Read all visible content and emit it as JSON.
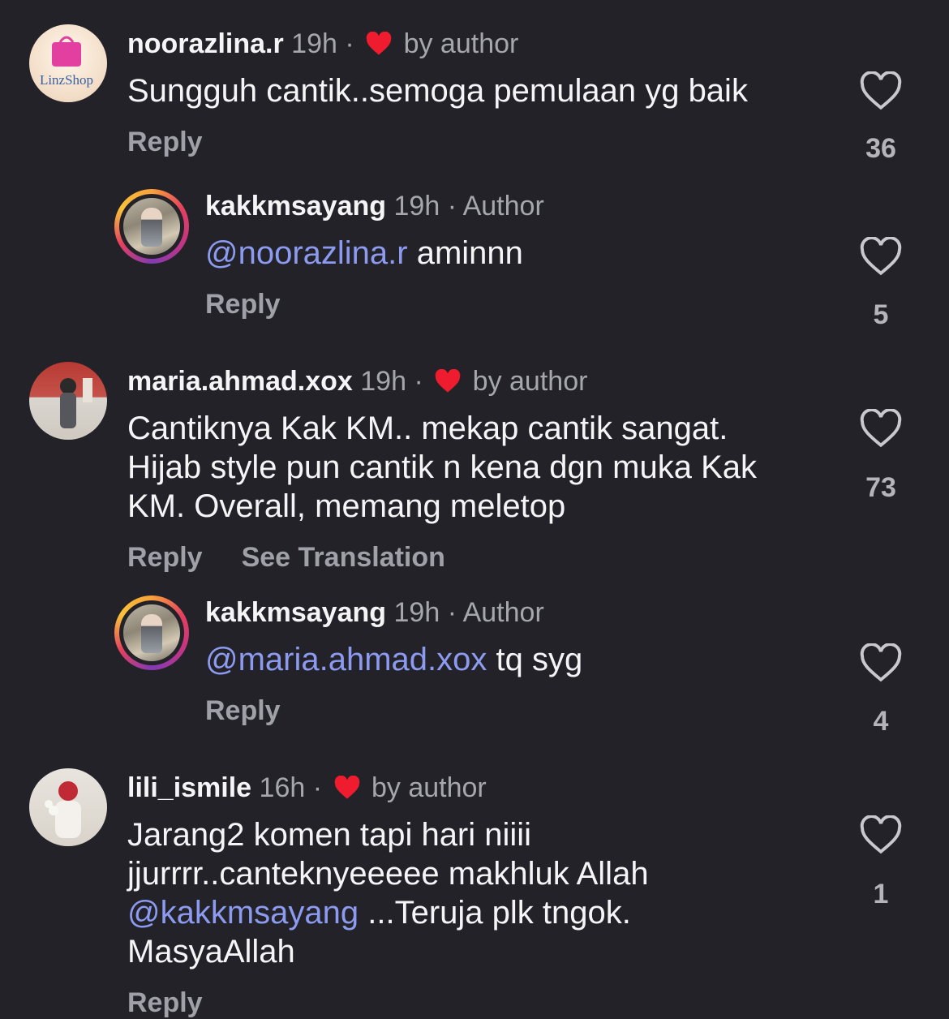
{
  "colors": {
    "background": "#222228",
    "mention": "#8c9bf0",
    "heart_red": "#ee1c2e",
    "muted": "#a6a6ad"
  },
  "comments": [
    {
      "username": "noorazlina.r",
      "time": "19h",
      "liked_by_author": "by author",
      "text": "Sungguh cantik..semoga pemulaan yg baik",
      "reply_label": "Reply",
      "likes": "36",
      "avatar_logo": "LinzShop"
    },
    {
      "username": "kakkmsayang",
      "time": "19h",
      "author_tag": "Author",
      "mention": "@noorazlina.r",
      "text": " aminnn",
      "reply_label": "Reply",
      "likes": "5"
    },
    {
      "username": "maria.ahmad.xox",
      "time": "19h",
      "liked_by_author": "by author",
      "text_lines": [
        "Cantiknya Kak KM.. mekap cantik sangat.",
        "Hijab style pun cantik n kena dgn muka Kak",
        "KM. Overall, memang meletop"
      ],
      "reply_label": "Reply",
      "translate_label": "See Translation",
      "likes": "73"
    },
    {
      "username": "kakkmsayang",
      "time": "19h",
      "author_tag": "Author",
      "mention": "@maria.ahmad.xox",
      "text": " tq syg",
      "reply_label": "Reply",
      "likes": "4"
    },
    {
      "username": "lili_ismile",
      "time": "16h",
      "liked_by_author": "by author",
      "line1": "Jarang2 komen tapi hari niiii",
      "line2": "jjurrrr..canteknyeeeee makhluk Allah",
      "mention": "@kakkmsayang",
      "line3_rest": " ...Teruja plk tngok.",
      "line4": "MasyaAllah",
      "reply_label": "Reply",
      "likes": "1"
    }
  ],
  "separator": "·"
}
